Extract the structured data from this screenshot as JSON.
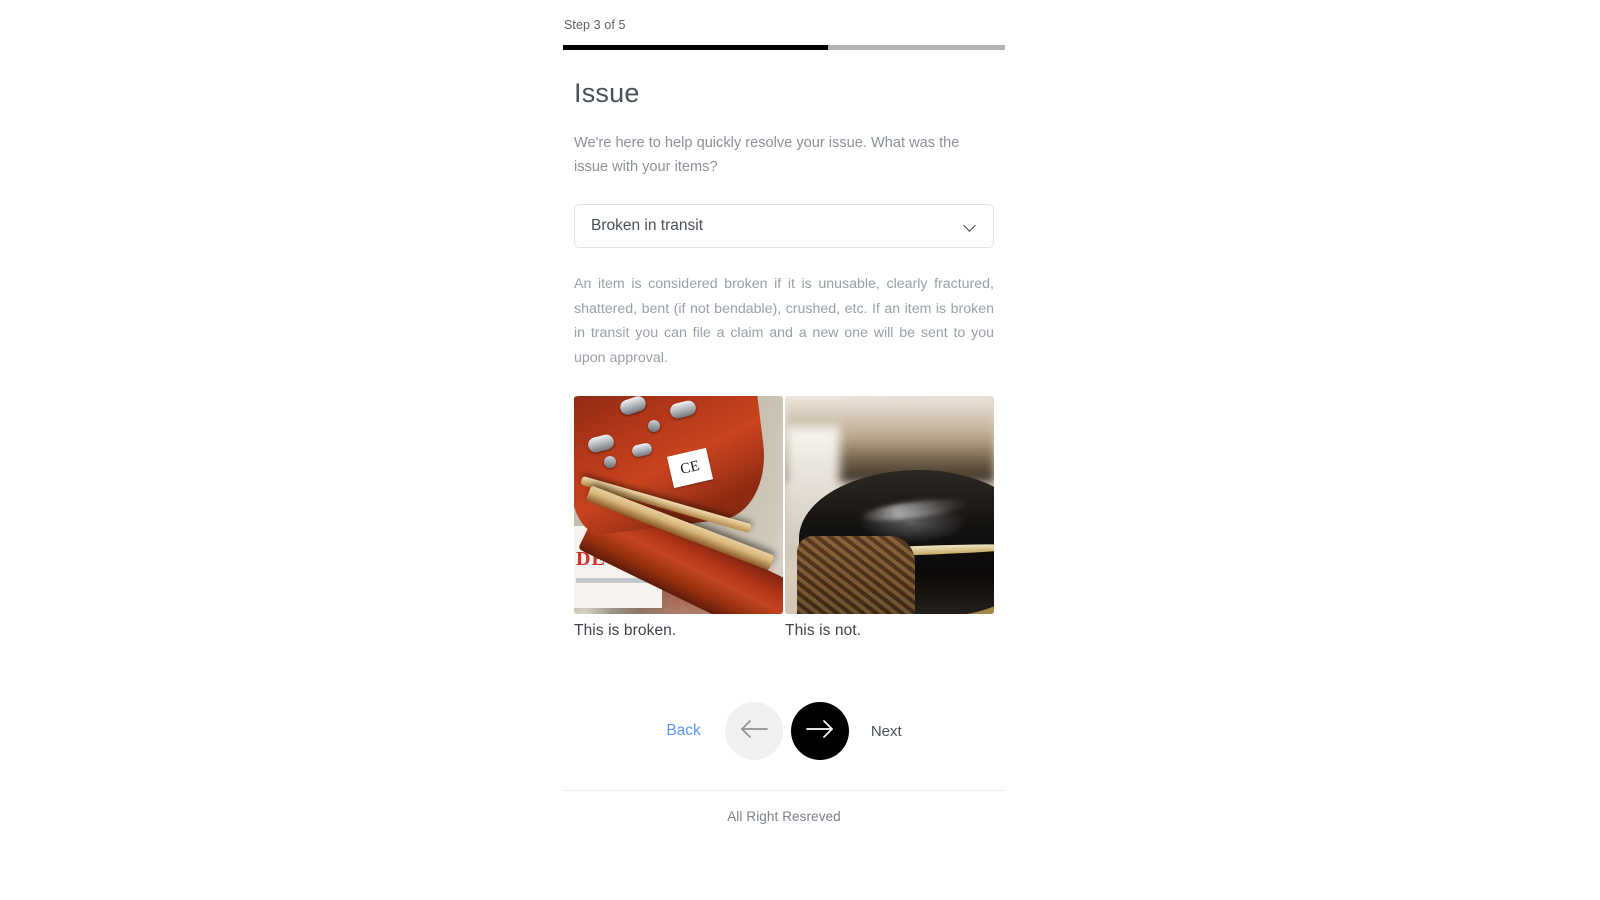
{
  "progress": {
    "step_label": "Step 3 of 5",
    "current_step": 3,
    "total_steps": 5,
    "percent_complete": 60,
    "fill_color": "#000000",
    "track_color": "#b3b3b3"
  },
  "form": {
    "title": "Issue",
    "lead": "We're here to help quickly resolve your issue. What was the issue with your items?",
    "select": {
      "selected_value": "Broken in transit",
      "icon": "chevron-down-icon"
    },
    "definition": "An item is considered broken if it is unusable, clearly fractured, shattered, bent (if not bendable), crushed, etc. If an item is broken in transit you can file a claim and a new one will be sent to you upon approval."
  },
  "examples": [
    {
      "caption": "This is broken.",
      "alt": "broken guitar headstock photo",
      "ce_mark": "CE",
      "poster_text": "DE UP"
    },
    {
      "caption": "This is not.",
      "alt": "intact glossy black guitar body photo"
    }
  ],
  "nav": {
    "back_label": "Back",
    "next_label": "Next",
    "prev_icon": "arrow-left-icon",
    "next_icon": "arrow-right-icon",
    "back_color": "#5b9bf3",
    "next_button_color": "#000000"
  },
  "footer": {
    "text": "All Right Resreved"
  }
}
